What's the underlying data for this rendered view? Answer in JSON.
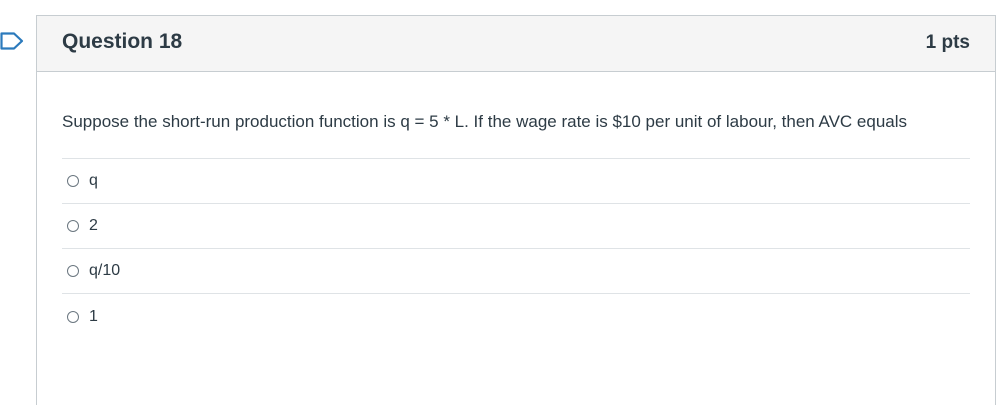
{
  "question": {
    "title": "Question 18",
    "points": "1 pts",
    "text": "Suppose the short-run production function is q = 5 * L. If the wage rate is $10 per unit of labour, then AVC equals",
    "answers": [
      {
        "label": "q",
        "selected": false
      },
      {
        "label": "2",
        "selected": false
      },
      {
        "label": "q/10",
        "selected": false
      },
      {
        "label": "1",
        "selected": false
      }
    ]
  },
  "colors": {
    "flag_outline": "#2b7abc",
    "header_bg": "#f5f5f5",
    "border": "#c7cdd1",
    "text": "#2d3b45"
  },
  "icons": {
    "flag": "flag-question-icon",
    "radio": "radio-unchecked-icon"
  }
}
